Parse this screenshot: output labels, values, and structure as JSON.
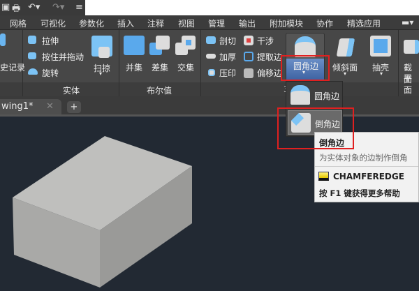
{
  "menu_tabs": [
    "网格",
    "可视化",
    "参数化",
    "插入",
    "注释",
    "视图",
    "管理",
    "输出",
    "附加模块",
    "协作",
    "精选应用"
  ],
  "ribbon": {
    "history_label": "史记录",
    "solid": {
      "extrude": "拉伸",
      "presspull": "按住并拖动",
      "revolve": "旋转",
      "sweep": "扫掠",
      "panel": "实体"
    },
    "boolean": {
      "union": "并集",
      "subtract": "差集",
      "intersect": "交集",
      "panel": "布尔值"
    },
    "edit": {
      "slice": "剖切",
      "thicken": "加厚",
      "imprint": "压印",
      "interfere": "干涉",
      "extract": "提取边",
      "offset": "偏移边",
      "fillet": "圆角边",
      "taper": "倾斜面",
      "shell": "抽壳",
      "section": "截面",
      "section2": "平面",
      "panel_partial": "3"
    }
  },
  "document_tab": {
    "title": "wing1*"
  },
  "dropdown": {
    "items": [
      "圆角边",
      "倒角边"
    ]
  },
  "tooltip": {
    "title": "倒角边",
    "description": "为实体对象的边制作倒角",
    "command": "CHAMFEREDGE",
    "help": "按 F1 键获得更多帮助"
  },
  "colors": {
    "accent": "#5b8fd6",
    "highlight_box": "#e02020"
  }
}
